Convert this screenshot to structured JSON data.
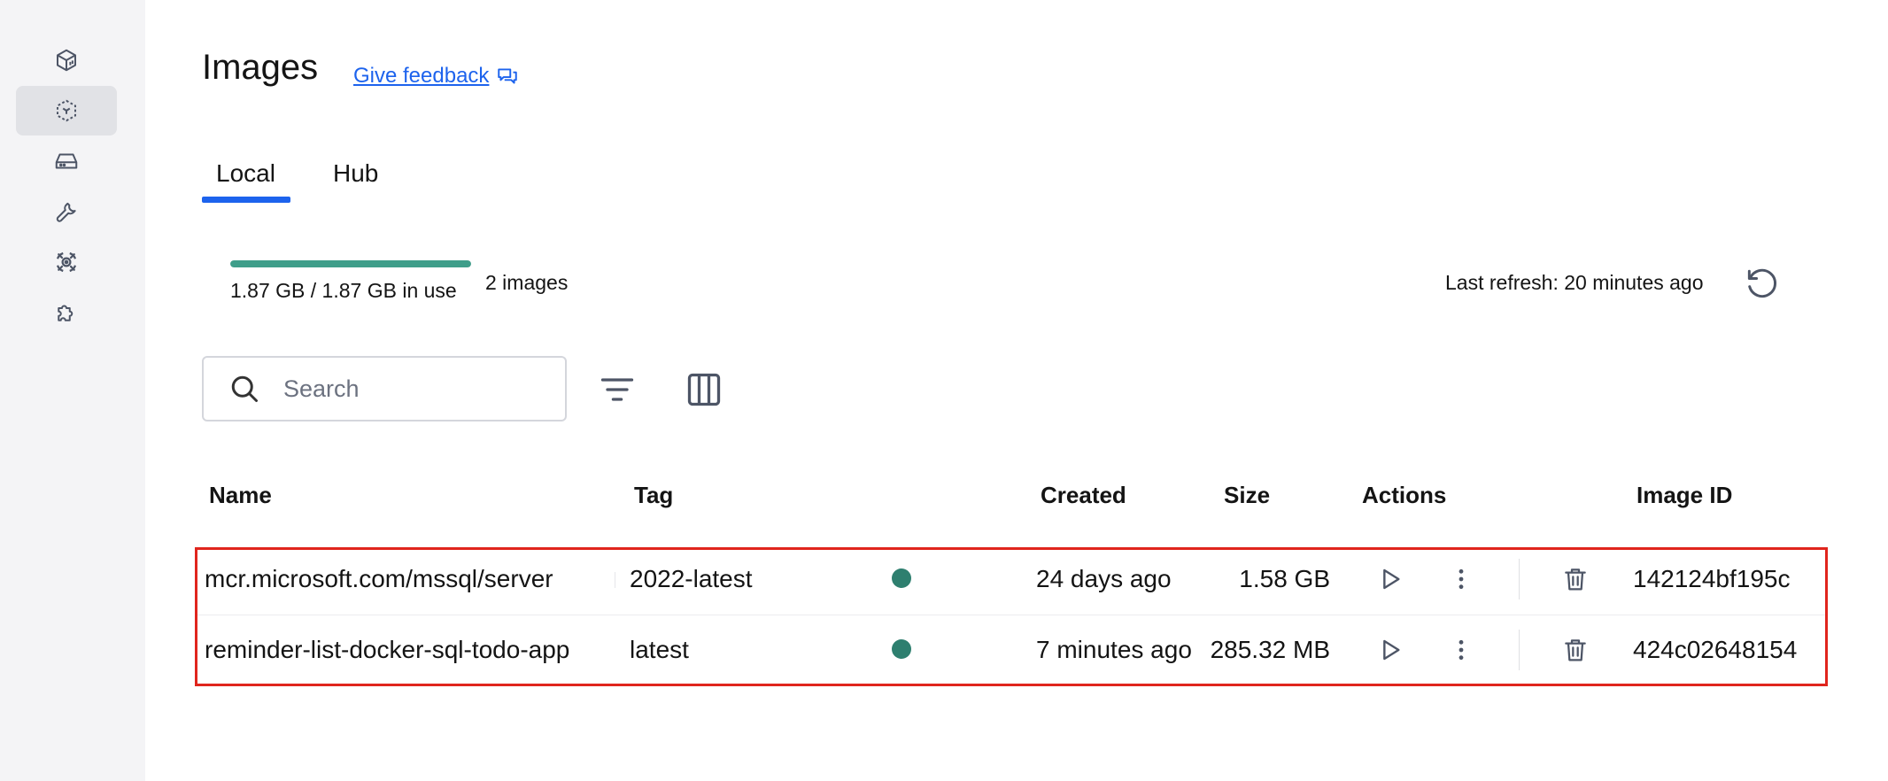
{
  "sidebar": {
    "items": [
      {
        "icon": "containers-icon"
      },
      {
        "icon": "images-icon",
        "active": true
      },
      {
        "icon": "volumes-icon"
      },
      {
        "icon": "dev-environments-icon"
      },
      {
        "icon": "scout-icon"
      },
      {
        "icon": "extensions-icon"
      }
    ]
  },
  "header": {
    "title": "Images",
    "feedback_link": "Give feedback"
  },
  "tabs": [
    {
      "label": "Local",
      "active": true
    },
    {
      "label": "Hub",
      "active": false
    }
  ],
  "usage": {
    "text": "1.87 GB / 1.87 GB in use",
    "fill_fraction": 1.0,
    "images_count": "2 images"
  },
  "refresh": {
    "text": "Last refresh: 20 minutes ago"
  },
  "search": {
    "placeholder": "Search",
    "value": ""
  },
  "table": {
    "columns": [
      "Name",
      "Tag",
      "Created",
      "Size",
      "Actions",
      "Image ID"
    ],
    "rows": [
      {
        "name": "mcr.microsoft.com/mssql/server",
        "tag": "2022-latest",
        "status": "in-use",
        "created": "24 days ago",
        "size": "1.58 GB",
        "image_id": "142124bf195c"
      },
      {
        "name": "reminder-list-docker-sql-todo-app",
        "tag": "latest",
        "status": "in-use",
        "created": "7 minutes ago",
        "size": "285.32 MB",
        "image_id": "424c02648154"
      }
    ]
  },
  "colors": {
    "accent": "#1d63ed",
    "usage_bar": "#3f9e8a",
    "status_dot": "#2e7f6f",
    "highlight": "#e0251d"
  }
}
